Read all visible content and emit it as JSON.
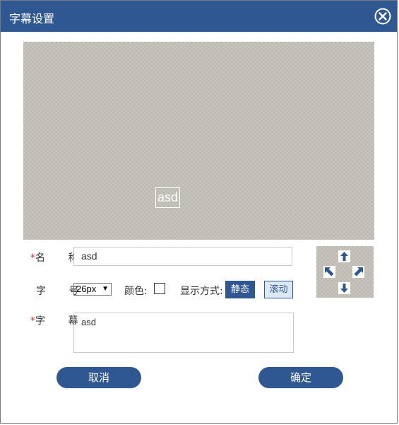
{
  "dialog": {
    "title": "字幕设置"
  },
  "preview": {
    "text": "asd"
  },
  "form": {
    "name_label": "名 称",
    "name_value": "asd",
    "size_label": "字 号",
    "size_value": "26px",
    "color_label": "颜色:",
    "mode_label": "显示方式:",
    "mode_static": "静态",
    "mode_scroll": "滚动",
    "subtitle_label": "字 幕",
    "subtitle_value": "asd",
    "required_mark": "*"
  },
  "buttons": {
    "cancel": "取消",
    "confirm": "确定"
  },
  "colors": {
    "accent": "#2f5791",
    "required": "#e0302b"
  },
  "icons": [
    "close-icon",
    "arrow-up-icon",
    "arrow-up-left-icon",
    "arrow-up-right-icon",
    "arrow-down-icon"
  ]
}
